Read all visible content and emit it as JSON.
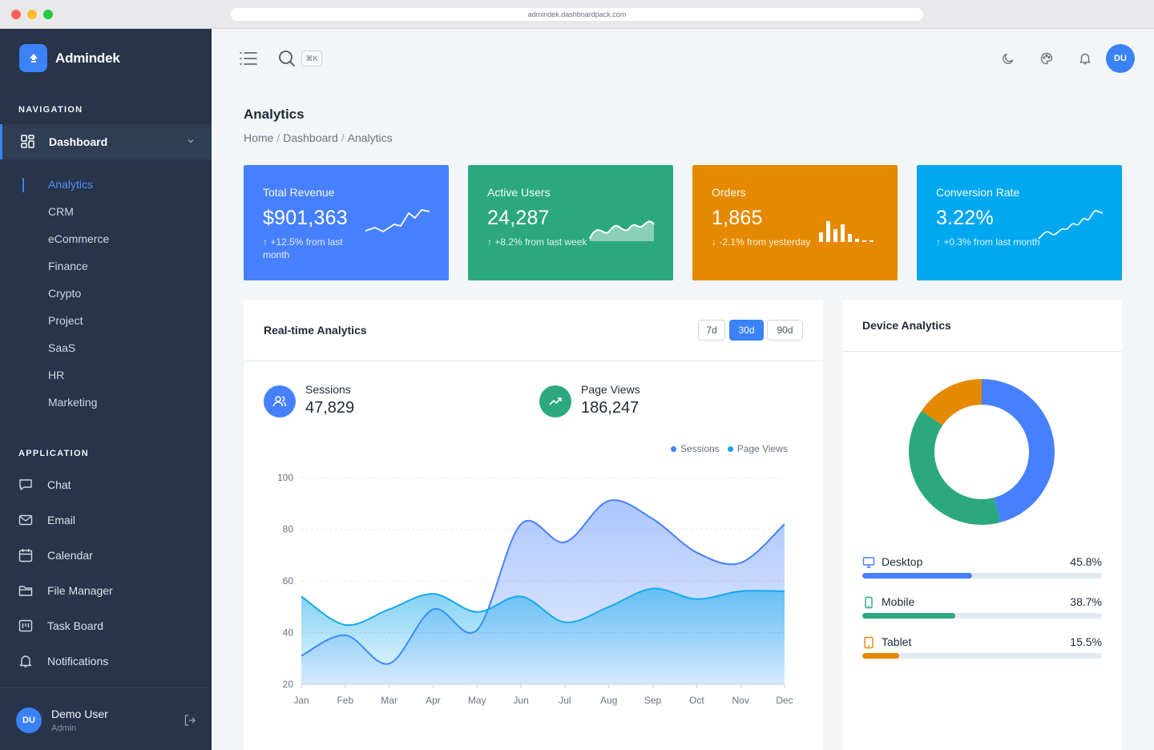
{
  "browser": {
    "url": "admindek.dashboardpack.com"
  },
  "brand": {
    "name": "Admindek"
  },
  "nav": {
    "section_title": "NAVIGATION",
    "dashboard_label": "Dashboard",
    "sub_items": [
      "Analytics",
      "CRM",
      "eCommerce",
      "Finance",
      "Crypto",
      "Project",
      "SaaS",
      "HR",
      "Marketing"
    ],
    "active_sub": "Analytics"
  },
  "application": {
    "section_title": "APPLICATION",
    "items": [
      {
        "label": "Chat",
        "icon": "chat-icon"
      },
      {
        "label": "Email",
        "icon": "email-icon"
      },
      {
        "label": "Calendar",
        "icon": "calendar-icon"
      },
      {
        "label": "File Manager",
        "icon": "folder-icon"
      },
      {
        "label": "Task Board",
        "icon": "task-board-icon"
      },
      {
        "label": "Notifications",
        "icon": "bell-icon"
      }
    ]
  },
  "user": {
    "initials": "DU",
    "name": "Demo User",
    "role": "Admin"
  },
  "topbar": {
    "shortcut": "⌘K",
    "avatar_initials": "DU"
  },
  "page": {
    "title": "Analytics",
    "breadcrumb": [
      "Home",
      "Dashboard",
      "Analytics"
    ]
  },
  "stats": [
    {
      "title": "Total Revenue",
      "value": "$901,363",
      "change": "↑ +12.5% from last month",
      "color": "#4680ff",
      "trend": "up"
    },
    {
      "title": "Active Users",
      "value": "24,287",
      "change": "↑ +8.2% from last week",
      "color": "#2ca87f",
      "trend": "up"
    },
    {
      "title": "Orders",
      "value": "1,865",
      "change": "↓ -2.1% from yesterday",
      "color": "#e58a00",
      "trend": "down"
    },
    {
      "title": "Conversion Rate",
      "value": "3.22%",
      "change": "↑ +0.3% from last month",
      "color": "#00a8f0",
      "trend": "up"
    }
  ],
  "realtime": {
    "title": "Real-time Analytics",
    "ranges": [
      "7d",
      "30d",
      "90d"
    ],
    "active_range": "30d",
    "sessions": {
      "label": "Sessions",
      "value": "47,829"
    },
    "pageviews": {
      "label": "Page Views",
      "value": "186,247"
    }
  },
  "chart_data": {
    "type": "area",
    "categories": [
      "Jan",
      "Feb",
      "Mar",
      "Apr",
      "May",
      "Jun",
      "Jul",
      "Aug",
      "Sep",
      "Oct",
      "Nov",
      "Dec"
    ],
    "series": [
      {
        "name": "Sessions",
        "color": "#4680ff",
        "values": [
          31,
          39,
          28,
          49,
          41,
          82,
          75,
          91,
          84,
          71,
          67,
          82
        ]
      },
      {
        "name": "Page Views",
        "color": "#13a9ee",
        "values": [
          54,
          43,
          49,
          55,
          48,
          54,
          44,
          50,
          57,
          53,
          56,
          56
        ]
      }
    ],
    "ylim": [
      20,
      100
    ],
    "yticks": [
      20,
      40,
      60,
      80,
      100
    ],
    "legend": "top-right",
    "grid": true
  },
  "device": {
    "title": "Device Analytics",
    "items": [
      {
        "label": "Desktop",
        "value": "45.8%",
        "pct": 45.8,
        "color": "#4680ff",
        "icon": "desktop-icon"
      },
      {
        "label": "Mobile",
        "value": "38.7%",
        "pct": 38.7,
        "color": "#2ca87f",
        "icon": "mobile-icon"
      },
      {
        "label": "Tablet",
        "value": "15.5%",
        "pct": 15.5,
        "color": "#e58a00",
        "icon": "tablet-icon"
      }
    ]
  }
}
